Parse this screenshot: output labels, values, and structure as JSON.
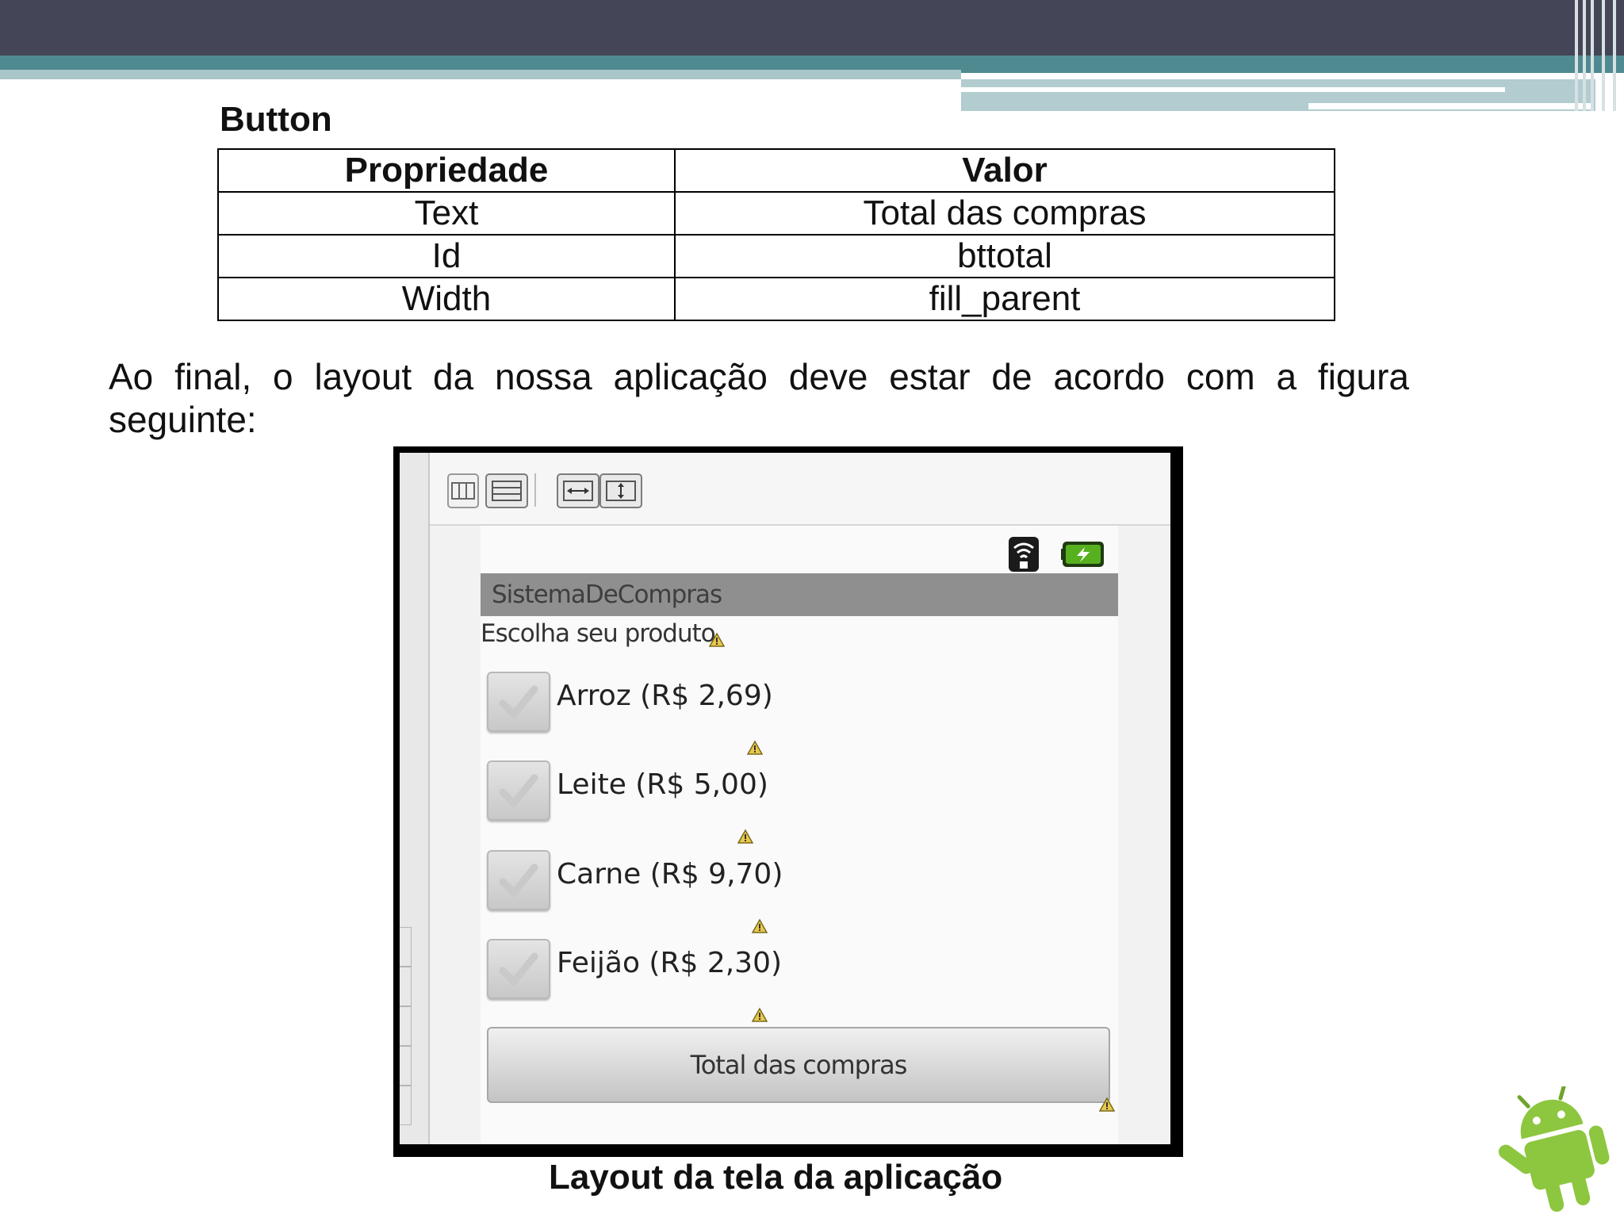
{
  "section_title": "Button",
  "table": {
    "headers": [
      "Propriedade",
      "Valor"
    ],
    "rows": [
      [
        "Text",
        "Total das compras"
      ],
      [
        "Id",
        "bttotal"
      ],
      [
        "Width",
        "fill_parent"
      ]
    ]
  },
  "paragraph": "Ao final, o layout da nossa aplicação deve estar de acordo com a figura seguinte:",
  "figure": {
    "toolbar_icons": [
      "columns-layout-icon",
      "rows-layout-icon",
      "fit-width-icon",
      "fit-height-icon"
    ],
    "status_icons": [
      "wifi-icon",
      "battery-icon"
    ],
    "app_title": "SistemaDeCompras",
    "prompt": "Escolha seu produto",
    "checkboxes": [
      "Arroz (R$ 2,69)",
      "Leite (R$ 5,00)",
      "Carne (R$ 9,70)",
      "Feijão (R$ 2,30)"
    ],
    "button_label": "Total das compras"
  },
  "caption": "Layout da tela da aplicação",
  "colors": {
    "header_dark": "#454558",
    "header_teal": "#4f8a91",
    "android_green": "#8dc63f"
  }
}
